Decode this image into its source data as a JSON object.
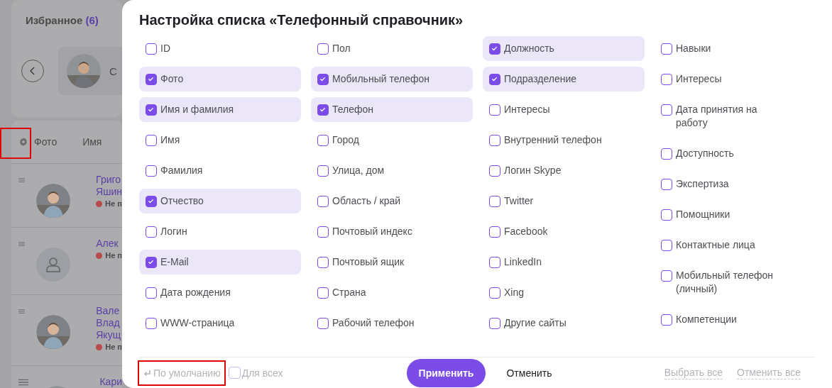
{
  "background": {
    "favorites_title": "Избранное",
    "favorites_count": "(6)",
    "contact_initial": "С",
    "settings_highlighted": true,
    "columns": [
      "Фото",
      "Имя"
    ],
    "rows": [
      {
        "name_lines": [
          "Григо",
          "Яшин"
        ],
        "status": "Не п"
      },
      {
        "kind": "placeholder",
        "name_lines": [
          "Алек"
        ],
        "status": "Не п"
      },
      {
        "name_lines": [
          "Вале",
          "Влад",
          "Якущ"
        ],
        "status": "Не п"
      },
      {
        "name_lines": [
          "Кари"
        ]
      }
    ]
  },
  "dialog": {
    "title": "Настройка списка «Телефонный справочник»",
    "columns": [
      [
        {
          "label": "ID",
          "checked": false
        },
        {
          "label": "Фото",
          "checked": true
        },
        {
          "label": "Имя и фамилия",
          "checked": true
        },
        {
          "label": "Имя",
          "checked": false
        },
        {
          "label": "Фамилия",
          "checked": false
        },
        {
          "label": "Отчество",
          "checked": true
        },
        {
          "label": "Логин",
          "checked": false
        },
        {
          "label": "E-Mail",
          "checked": true
        },
        {
          "label": "Дата рождения",
          "checked": false
        },
        {
          "label": "WWW-страница",
          "checked": false
        }
      ],
      [
        {
          "label": "Пол",
          "checked": false
        },
        {
          "label": "Мобильный телефон",
          "checked": true
        },
        {
          "label": "Телефон",
          "checked": true
        },
        {
          "label": "Город",
          "checked": false
        },
        {
          "label": "Улица, дом",
          "checked": false
        },
        {
          "label": "Область / край",
          "checked": false
        },
        {
          "label": "Почтовый индекс",
          "checked": false
        },
        {
          "label": "Почтовый ящик",
          "checked": false
        },
        {
          "label": "Страна",
          "checked": false
        },
        {
          "label": "Рабочий телефон",
          "checked": false
        }
      ],
      [
        {
          "label": "Должность",
          "checked": true
        },
        {
          "label": "Подразделение",
          "checked": true
        },
        {
          "label": "Интересы",
          "checked": false
        },
        {
          "label": "Внутренний телефон",
          "checked": false
        },
        {
          "label": "Логин Skype",
          "checked": false
        },
        {
          "label": "Twitter",
          "checked": false
        },
        {
          "label": "Facebook",
          "checked": false
        },
        {
          "label": "LinkedIn",
          "checked": false
        },
        {
          "label": "Xing",
          "checked": false
        },
        {
          "label": "Другие сайты",
          "checked": false
        }
      ],
      [
        {
          "label": "Навыки",
          "checked": false
        },
        {
          "label": "Интересы",
          "checked": false
        },
        {
          "label": "Дата принятия на работу",
          "checked": false
        },
        {
          "label": "Доступность",
          "checked": false
        },
        {
          "label": "Экспертиза",
          "checked": false
        },
        {
          "label": "Помощники",
          "checked": false
        },
        {
          "label": "Контактные лица",
          "checked": false
        },
        {
          "label": "Мобильный телефон (личный)",
          "checked": false
        },
        {
          "label": "Компетенции",
          "checked": false
        }
      ]
    ],
    "footer": {
      "default_label": "По умолчанию",
      "default_highlighted": true,
      "for_all": {
        "label": "Для всех",
        "checked": false
      },
      "apply": "Применить",
      "cancel": "Отменить",
      "select_all": "Выбрать все",
      "deselect_all": "Отменить все"
    }
  }
}
